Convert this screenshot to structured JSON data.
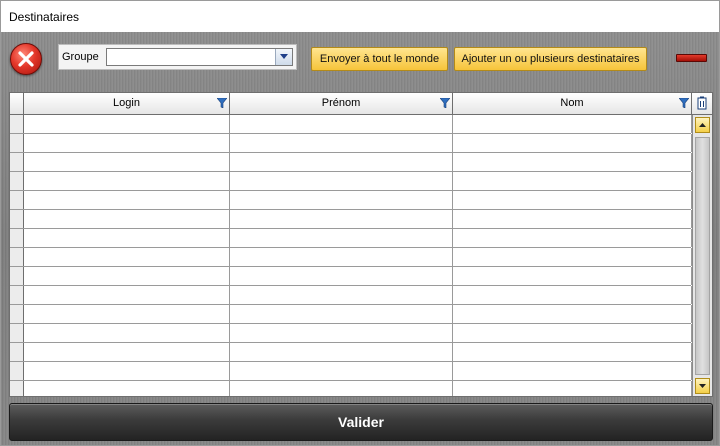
{
  "window": {
    "title": "Destinataires"
  },
  "toolbar": {
    "group_label": "Groupe",
    "group_value": "",
    "send_all_label": "Envoyer à tout le monde",
    "add_recipients_label": "Ajouter un ou plusieurs destinataires"
  },
  "grid": {
    "columns": [
      "Login",
      "Prénom",
      "Nom"
    ],
    "rows": [
      [
        "",
        "",
        ""
      ],
      [
        "",
        "",
        ""
      ],
      [
        "",
        "",
        ""
      ],
      [
        "",
        "",
        ""
      ],
      [
        "",
        "",
        ""
      ],
      [
        "",
        "",
        ""
      ],
      [
        "",
        "",
        ""
      ],
      [
        "",
        "",
        ""
      ],
      [
        "",
        "",
        ""
      ],
      [
        "",
        "",
        ""
      ],
      [
        "",
        "",
        ""
      ],
      [
        "",
        "",
        ""
      ],
      [
        "",
        "",
        ""
      ],
      [
        "",
        "",
        ""
      ],
      [
        "",
        "",
        ""
      ]
    ]
  },
  "footer": {
    "validate_label": "Valider"
  },
  "colors": {
    "accent_yellow": "#f6c43a",
    "indicator_red": "#c8231a",
    "validate_dark": "#333333"
  },
  "icons": {
    "close": "close-icon",
    "dropdown": "chevron-down-icon",
    "filter": "filter-icon",
    "column_chooser": "column-chooser-icon",
    "scroll_up": "scroll-up-icon",
    "scroll_down": "scroll-down-icon"
  }
}
